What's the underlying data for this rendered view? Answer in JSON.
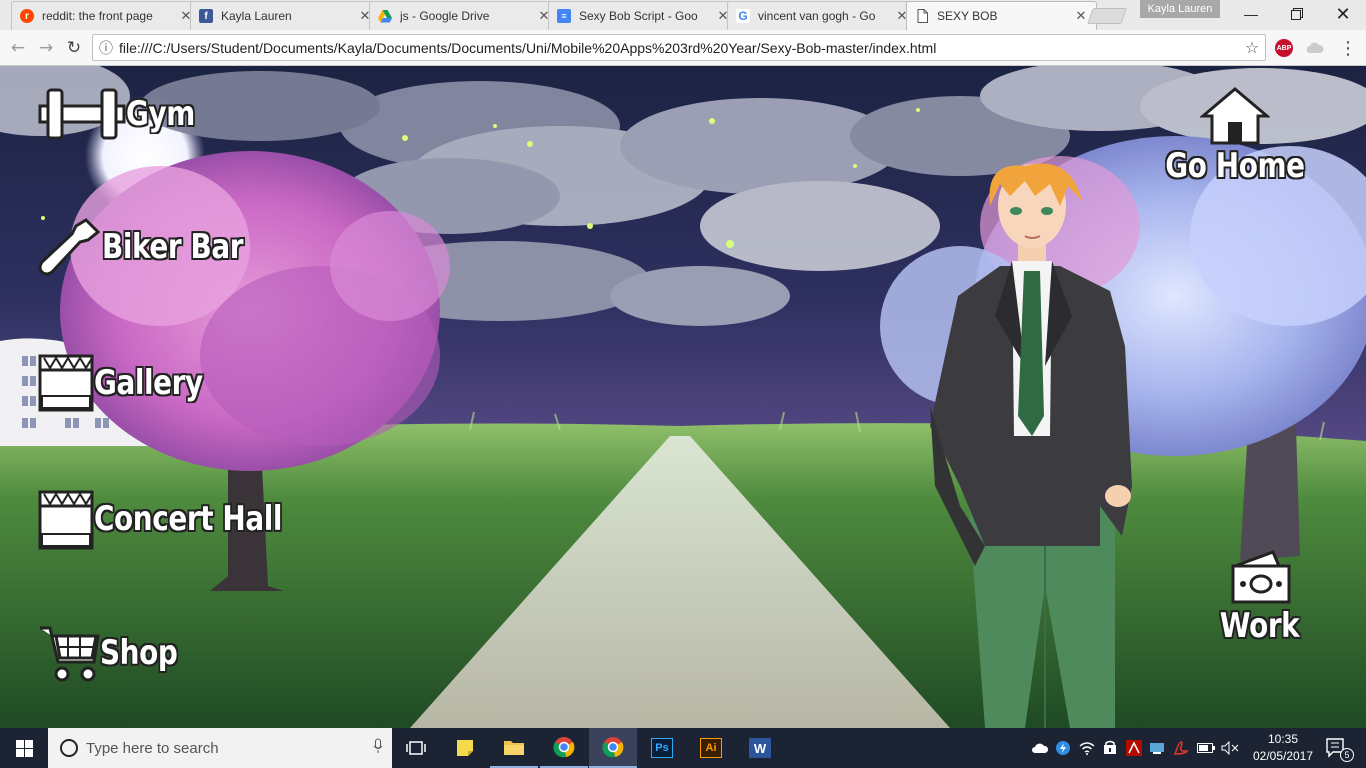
{
  "browser": {
    "tabs": [
      {
        "title": "reddit: the front page",
        "icon": "reddit-icon",
        "fav_color": "#ff4500",
        "fav_glyph": "r"
      },
      {
        "title": "Kayla Lauren",
        "icon": "facebook-icon",
        "fav_color": "#3b5998",
        "fav_glyph": "f"
      },
      {
        "title": "js - Google Drive",
        "icon": "google-drive-icon",
        "fav_color": "#f4b400",
        "fav_glyph": "▲"
      },
      {
        "title": "Sexy Bob Script - Goo",
        "icon": "google-docs-icon",
        "fav_color": "#4285f4",
        "fav_glyph": "≡"
      },
      {
        "title": "vincent van gogh - Go",
        "icon": "google-icon",
        "fav_color": "#ffffff",
        "fav_glyph": "G"
      },
      {
        "title": "SEXY BOB",
        "icon": "page-icon",
        "fav_color": "#ffffff",
        "fav_glyph": ""
      }
    ],
    "close_glyph": "✕",
    "profile_name": "Kayla Lauren",
    "url": "file:///C:/Users/Student/Documents/Kayla/Documents/Documents/Uni/Mobile%20Apps%203rd%20Year/Sexy-Bob-master/index.html",
    "extensions": [
      {
        "name": "adblock-plus-icon",
        "label": "ABP",
        "color": "#c70d2c"
      }
    ]
  },
  "game": {
    "nav_left": [
      {
        "label": "Gym",
        "icon": "dumbbell-icon"
      },
      {
        "label": "Biker Bar",
        "icon": "bottle-icon"
      },
      {
        "label": "Gallery",
        "icon": "gallery-building-icon"
      },
      {
        "label": "Concert Hall",
        "icon": "concert-hall-icon"
      },
      {
        "label": "Shop",
        "icon": "shopping-cart-icon"
      }
    ],
    "nav_right": [
      {
        "label": "Go Home",
        "icon": "house-icon"
      },
      {
        "label": "Work",
        "icon": "money-icon"
      }
    ],
    "character": "bob-character"
  },
  "taskbar": {
    "search_placeholder": "Type here to search",
    "apps": [
      {
        "name": "task-view-icon"
      },
      {
        "name": "sticky-notes-icon"
      },
      {
        "name": "file-explorer-icon"
      },
      {
        "name": "chrome-icon"
      },
      {
        "name": "chrome-active-icon"
      },
      {
        "name": "photoshop-icon",
        "label": "Ps"
      },
      {
        "name": "illustrator-icon",
        "label": "Ai"
      },
      {
        "name": "word-icon",
        "label": "W"
      }
    ],
    "time": "10:35",
    "date": "02/05/2017",
    "notification_count": "5"
  }
}
